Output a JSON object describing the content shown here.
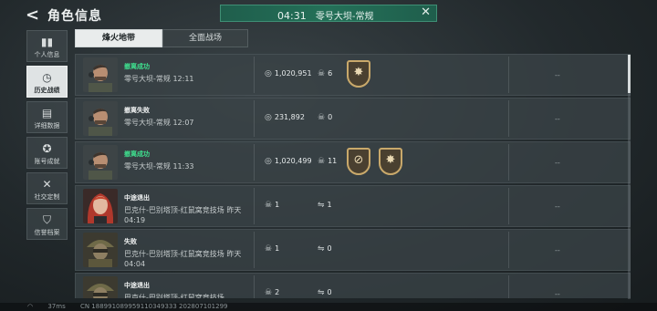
{
  "header": {
    "back_label": "<",
    "title": "角色信息"
  },
  "match_bar": {
    "time": "04:31",
    "mode": "零号大坝-常规"
  },
  "sidebar": {
    "items": [
      {
        "label": "个人信息",
        "icon": "bar-chart-icon",
        "glyph": "▮▮",
        "active": false
      },
      {
        "label": "历史战绩",
        "icon": "clock-icon",
        "glyph": "◷",
        "active": true
      },
      {
        "label": "详细数据",
        "icon": "document-icon",
        "glyph": "▤",
        "active": false
      },
      {
        "label": "账号成就",
        "icon": "medal-icon",
        "glyph": "✪",
        "active": false
      },
      {
        "label": "社交定制",
        "icon": "tools-icon",
        "glyph": "✕",
        "active": false
      },
      {
        "label": "信誉档案",
        "icon": "shield-icon",
        "glyph": "⛉",
        "active": false
      }
    ]
  },
  "tabs": [
    {
      "label": "烽火地带",
      "active": true
    },
    {
      "label": "全面战场",
      "active": false
    }
  ],
  "rows": [
    {
      "result": "撤离成功",
      "result_type": "success",
      "map": "零号大坝-常规",
      "time": "12:11",
      "stat1": "1,020,951",
      "stat1_icon": "coin-icon",
      "stat2": "6",
      "stat2_icon": "skull-icon",
      "badges": [
        "crosshair-badge-icon"
      ],
      "extra": "--",
      "avatar": "soldier"
    },
    {
      "result": "撤离失败",
      "result_type": "plain",
      "map": "零号大坝-常规",
      "time": "12:07",
      "stat1": "231,892",
      "stat1_icon": "coin-icon",
      "stat2": "0",
      "stat2_icon": "skull-icon",
      "badges": [],
      "extra": "--",
      "avatar": "soldier"
    },
    {
      "result": "撤离成功",
      "result_type": "success",
      "map": "零号大坝-常规",
      "time": "11:33",
      "stat1": "1,020,499",
      "stat1_icon": "coin-icon",
      "stat2": "11",
      "stat2_icon": "skull-icon",
      "badges": [
        "target-slash-badge-icon",
        "crosshair-badge-icon"
      ],
      "extra": "--",
      "avatar": "soldier"
    },
    {
      "result": "中途退出",
      "result_type": "plain",
      "map": "巴克什-巴别塔顶-红鼠窝竞技场",
      "time": "昨天 04:19",
      "stat1": "1",
      "stat1_icon": "skull-icon",
      "stat2": "1",
      "stat2_icon": "handshake-icon",
      "badges": [],
      "extra": "--",
      "avatar": "redhair"
    },
    {
      "result": "失败",
      "result_type": "plain",
      "map": "巴克什-巴别塔顶-红鼠窝竞技场",
      "time": "昨天 04:04",
      "stat1": "1",
      "stat1_icon": "skull-icon",
      "stat2": "0",
      "stat2_icon": "handshake-icon",
      "badges": [],
      "extra": "--",
      "avatar": "camo"
    },
    {
      "result": "中途退出",
      "result_type": "plain",
      "map": "巴克什-巴别塔顶-红鼠窝竞技场",
      "time": "",
      "stat1": "2",
      "stat1_icon": "skull-icon",
      "stat2": "0",
      "stat2_icon": "handshake-icon",
      "badges": [],
      "extra": "--",
      "avatar": "camo"
    }
  ],
  "status": {
    "ping": "37ms",
    "id": "CN 188991089959110349333 202807101299"
  },
  "colors": {
    "accent_green": "#3fe08f",
    "match_bar": "#247058",
    "badge_gold": "#c9a96b"
  }
}
